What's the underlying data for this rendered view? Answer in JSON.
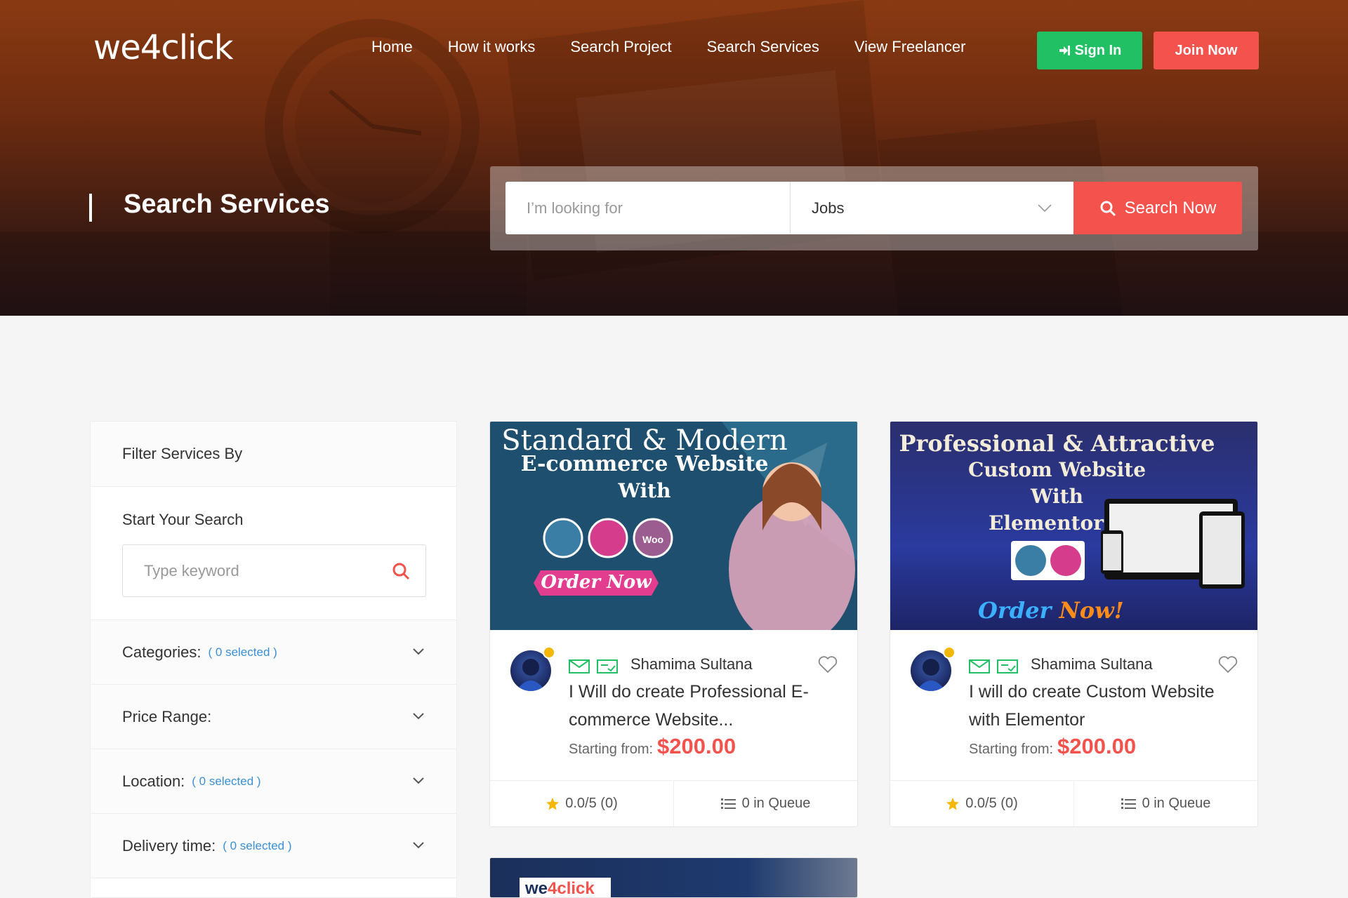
{
  "brand": {
    "logo": "we4click"
  },
  "nav": {
    "items": [
      "Home",
      "How it works",
      "Search Project",
      "Search Services",
      "View Freelancer"
    ],
    "sign_in": "Sign In",
    "join": "Join Now"
  },
  "hero": {
    "title": "Search Services",
    "search_placeholder": "I’m looking for",
    "select_value": "Jobs",
    "search_button": "Search Now"
  },
  "colors": {
    "accent": "#f4524d",
    "green": "#22c064",
    "link": "#3a8fd6"
  },
  "sidebar": {
    "heading": "Filter Services By",
    "search_label": "Start Your Search",
    "keyword_placeholder": "Type keyword",
    "filters": [
      {
        "label": "Categories:",
        "selected": "( 0 selected )"
      },
      {
        "label": "Price Range:",
        "selected": ""
      },
      {
        "label": "Location:",
        "selected": "( 0 selected )"
      },
      {
        "label": "Delivery time:",
        "selected": "( 0 selected )"
      }
    ]
  },
  "cards": [
    {
      "img_lines": [
        "Standard & Modern",
        "E-commerce Website",
        "With"
      ],
      "img_cta": "Order Now",
      "img_badge": "Woo",
      "seller": "Shamima Sultana",
      "title": "I Will do create Professional E-commerce Website...",
      "price_label": "Starting from:",
      "price": "$200.00",
      "rating": "0.0/5 (0)",
      "queue": "0 in Queue"
    },
    {
      "img_lines": [
        "Professional & Attractive",
        "Custom Website",
        "With",
        "Elementor"
      ],
      "img_cta_a": "Order",
      "img_cta_b": "Now!",
      "seller": "Shamima Sultana",
      "title": "I will do create Custom Website with Elementor",
      "price_label": "Starting from:",
      "price": "$200.00",
      "rating": "0.0/5 (0)",
      "queue": "0 in Queue"
    }
  ],
  "third_card": {
    "logo_a": "we",
    "logo_b": "4click"
  }
}
